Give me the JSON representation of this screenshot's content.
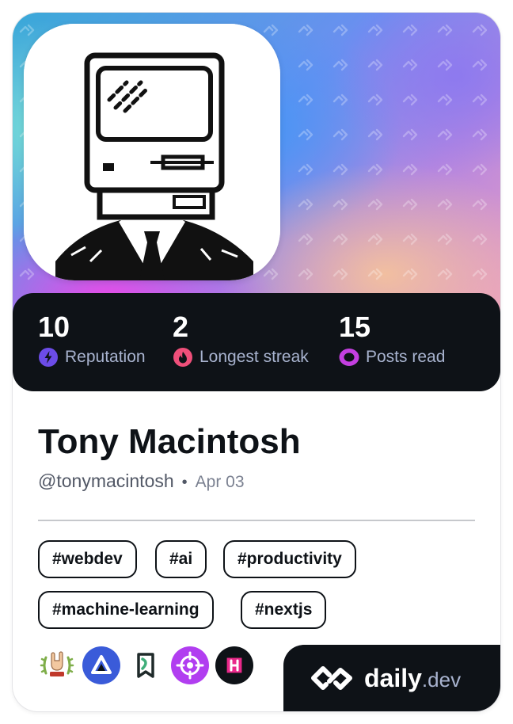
{
  "profile": {
    "name": "Tony Macintosh",
    "handle": "@tonymacintosh",
    "separator": "•",
    "joined": "Apr 03"
  },
  "stats": [
    {
      "value": "10",
      "label": "Reputation",
      "icon": "lightning-icon",
      "color": "#6c4ce8"
    },
    {
      "value": "2",
      "label": "Longest streak",
      "icon": "flame-icon",
      "color": "#ef4f7a"
    },
    {
      "value": "15",
      "label": "Posts read",
      "icon": "eye-icon",
      "color": "#c43fe0"
    }
  ],
  "tags": [
    "#webdev",
    "#ai",
    "#productivity",
    "#machine-learning",
    "#nextjs"
  ],
  "badges": [
    "rock-on-award-icon",
    "triangle-app-icon",
    "bookmark-app-icon",
    "target-icon",
    "hashnode-icon"
  ],
  "brand": {
    "name": "daily",
    "suffix": ".dev",
    "icon": "dailydev-logo-icon"
  },
  "colors": {
    "dark": "#0e1217",
    "label": "#a8b3cf",
    "accent_purple": "#6c4ce8",
    "accent_pink": "#ef4f7a",
    "accent_magenta": "#c43fe0"
  }
}
